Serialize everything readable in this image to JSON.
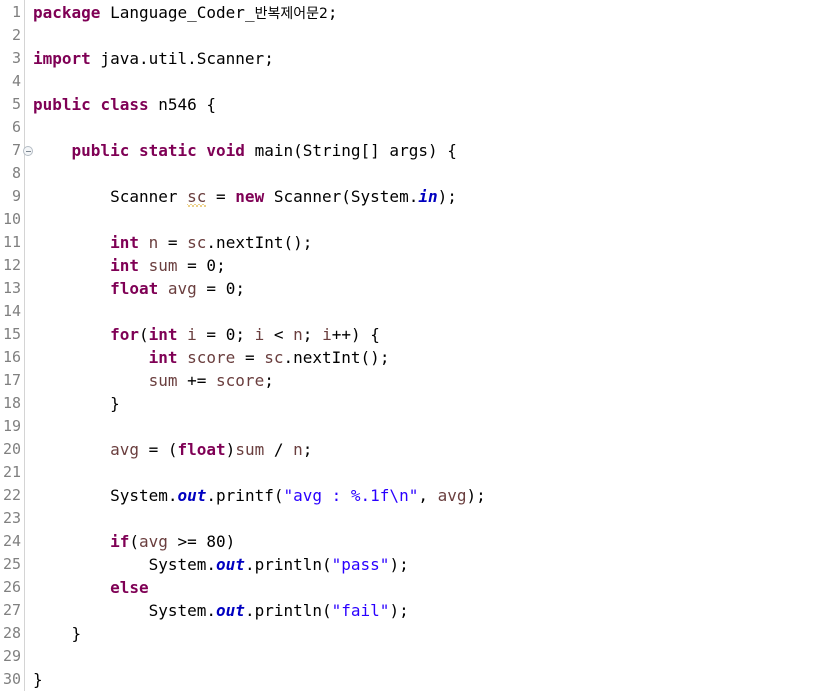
{
  "editor": {
    "language": "Java",
    "file_name": "n546.java",
    "total_lines": 30,
    "colors": {
      "background": "#ffffff",
      "gutter_text": "#808080",
      "gutter_border": "#d4d4d4",
      "keyword": "#7f0055",
      "string": "#2a00ff",
      "static_field": "#0000c0",
      "local_variable": "#6a3e3e",
      "plain_text": "#000000",
      "spell_warning": "#d9a013"
    },
    "fold_markers": [
      7
    ],
    "spell_warnings": [
      "sc"
    ]
  },
  "lines": [
    {
      "n": "1",
      "fold": false,
      "indent": 0,
      "tokens": [
        {
          "t": "package",
          "c": "kw"
        },
        {
          "t": " ",
          "c": "plain"
        },
        {
          "t": "Language_Coder_",
          "c": "plain"
        },
        {
          "t": "반복제어문2",
          "c": "hangul"
        },
        {
          "t": ";",
          "c": "plain"
        }
      ]
    },
    {
      "n": "2",
      "fold": false,
      "indent": 0,
      "tokens": []
    },
    {
      "n": "3",
      "fold": false,
      "indent": 0,
      "tokens": [
        {
          "t": "import",
          "c": "kw"
        },
        {
          "t": " java.util.Scanner;",
          "c": "plain"
        }
      ]
    },
    {
      "n": "4",
      "fold": false,
      "indent": 0,
      "tokens": []
    },
    {
      "n": "5",
      "fold": false,
      "indent": 0,
      "tokens": [
        {
          "t": "public",
          "c": "kw"
        },
        {
          "t": " ",
          "c": "plain"
        },
        {
          "t": "class",
          "c": "kw"
        },
        {
          "t": " n546 {",
          "c": "plain"
        }
      ]
    },
    {
      "n": "6",
      "fold": false,
      "indent": 0,
      "tokens": []
    },
    {
      "n": "7",
      "fold": true,
      "indent": 0,
      "tokens": [
        {
          "t": "    ",
          "c": "plain"
        },
        {
          "t": "public",
          "c": "kw"
        },
        {
          "t": " ",
          "c": "plain"
        },
        {
          "t": "static",
          "c": "kw"
        },
        {
          "t": " ",
          "c": "plain"
        },
        {
          "t": "void",
          "c": "kw"
        },
        {
          "t": " main(String[] args) {",
          "c": "plain"
        }
      ]
    },
    {
      "n": "8",
      "fold": false,
      "indent": 0,
      "tokens": []
    },
    {
      "n": "9",
      "fold": false,
      "indent": 0,
      "tokens": [
        {
          "t": "        Scanner ",
          "c": "plain"
        },
        {
          "t": "sc",
          "c": "localvar squiggle"
        },
        {
          "t": " = ",
          "c": "plain"
        },
        {
          "t": "new",
          "c": "kw"
        },
        {
          "t": " Scanner(System.",
          "c": "plain"
        },
        {
          "t": "in",
          "c": "statfld"
        },
        {
          "t": ");",
          "c": "plain"
        }
      ]
    },
    {
      "n": "10",
      "fold": false,
      "indent": 0,
      "tokens": []
    },
    {
      "n": "11",
      "fold": false,
      "indent": 0,
      "tokens": [
        {
          "t": "        ",
          "c": "plain"
        },
        {
          "t": "int",
          "c": "kw"
        },
        {
          "t": " ",
          "c": "plain"
        },
        {
          "t": "n",
          "c": "localvar"
        },
        {
          "t": " = ",
          "c": "plain"
        },
        {
          "t": "sc",
          "c": "localvar"
        },
        {
          "t": ".nextInt();",
          "c": "plain"
        }
      ]
    },
    {
      "n": "12",
      "fold": false,
      "indent": 0,
      "tokens": [
        {
          "t": "        ",
          "c": "plain"
        },
        {
          "t": "int",
          "c": "kw"
        },
        {
          "t": " ",
          "c": "plain"
        },
        {
          "t": "sum",
          "c": "localvar"
        },
        {
          "t": " = ",
          "c": "plain"
        },
        {
          "t": "0",
          "c": "num"
        },
        {
          "t": ";",
          "c": "plain"
        }
      ]
    },
    {
      "n": "13",
      "fold": false,
      "indent": 0,
      "tokens": [
        {
          "t": "        ",
          "c": "plain"
        },
        {
          "t": "float",
          "c": "kw"
        },
        {
          "t": " ",
          "c": "plain"
        },
        {
          "t": "avg",
          "c": "localvar"
        },
        {
          "t": " = ",
          "c": "plain"
        },
        {
          "t": "0",
          "c": "num"
        },
        {
          "t": ";",
          "c": "plain"
        }
      ]
    },
    {
      "n": "14",
      "fold": false,
      "indent": 0,
      "tokens": []
    },
    {
      "n": "15",
      "fold": false,
      "indent": 0,
      "tokens": [
        {
          "t": "        ",
          "c": "plain"
        },
        {
          "t": "for",
          "c": "kw"
        },
        {
          "t": "(",
          "c": "plain"
        },
        {
          "t": "int",
          "c": "kw"
        },
        {
          "t": " ",
          "c": "plain"
        },
        {
          "t": "i",
          "c": "localvar"
        },
        {
          "t": " = ",
          "c": "plain"
        },
        {
          "t": "0",
          "c": "num"
        },
        {
          "t": "; ",
          "c": "plain"
        },
        {
          "t": "i",
          "c": "localvar"
        },
        {
          "t": " < ",
          "c": "plain"
        },
        {
          "t": "n",
          "c": "localvar"
        },
        {
          "t": "; ",
          "c": "plain"
        },
        {
          "t": "i",
          "c": "localvar"
        },
        {
          "t": "++) {",
          "c": "plain"
        }
      ]
    },
    {
      "n": "16",
      "fold": false,
      "indent": 0,
      "tokens": [
        {
          "t": "            ",
          "c": "plain"
        },
        {
          "t": "int",
          "c": "kw"
        },
        {
          "t": " ",
          "c": "plain"
        },
        {
          "t": "score",
          "c": "localvar"
        },
        {
          "t": " = ",
          "c": "plain"
        },
        {
          "t": "sc",
          "c": "localvar"
        },
        {
          "t": ".nextInt();",
          "c": "plain"
        }
      ]
    },
    {
      "n": "17",
      "fold": false,
      "indent": 0,
      "tokens": [
        {
          "t": "            ",
          "c": "plain"
        },
        {
          "t": "sum",
          "c": "localvar"
        },
        {
          "t": " += ",
          "c": "plain"
        },
        {
          "t": "score",
          "c": "localvar"
        },
        {
          "t": ";",
          "c": "plain"
        }
      ]
    },
    {
      "n": "18",
      "fold": false,
      "indent": 0,
      "tokens": [
        {
          "t": "        }",
          "c": "plain"
        }
      ]
    },
    {
      "n": "19",
      "fold": false,
      "indent": 0,
      "tokens": []
    },
    {
      "n": "20",
      "fold": false,
      "indent": 0,
      "tokens": [
        {
          "t": "        ",
          "c": "plain"
        },
        {
          "t": "avg",
          "c": "localvar"
        },
        {
          "t": " = (",
          "c": "plain"
        },
        {
          "t": "float",
          "c": "kw"
        },
        {
          "t": ")",
          "c": "plain"
        },
        {
          "t": "sum",
          "c": "localvar"
        },
        {
          "t": " / ",
          "c": "plain"
        },
        {
          "t": "n",
          "c": "localvar"
        },
        {
          "t": ";",
          "c": "plain"
        }
      ]
    },
    {
      "n": "21",
      "fold": false,
      "indent": 0,
      "tokens": []
    },
    {
      "n": "22",
      "fold": false,
      "indent": 0,
      "tokens": [
        {
          "t": "        System.",
          "c": "plain"
        },
        {
          "t": "out",
          "c": "statfld"
        },
        {
          "t": ".printf(",
          "c": "plain"
        },
        {
          "t": "\"avg : %.1f\\n\"",
          "c": "str"
        },
        {
          "t": ", ",
          "c": "plain"
        },
        {
          "t": "avg",
          "c": "localvar"
        },
        {
          "t": ");",
          "c": "plain"
        }
      ]
    },
    {
      "n": "23",
      "fold": false,
      "indent": 0,
      "tokens": []
    },
    {
      "n": "24",
      "fold": false,
      "indent": 0,
      "tokens": [
        {
          "t": "        ",
          "c": "plain"
        },
        {
          "t": "if",
          "c": "kw"
        },
        {
          "t": "(",
          "c": "plain"
        },
        {
          "t": "avg",
          "c": "localvar"
        },
        {
          "t": " >= ",
          "c": "plain"
        },
        {
          "t": "80",
          "c": "num"
        },
        {
          "t": ")",
          "c": "plain"
        }
      ]
    },
    {
      "n": "25",
      "fold": false,
      "indent": 0,
      "tokens": [
        {
          "t": "            System.",
          "c": "plain"
        },
        {
          "t": "out",
          "c": "statfld"
        },
        {
          "t": ".println(",
          "c": "plain"
        },
        {
          "t": "\"pass\"",
          "c": "str"
        },
        {
          "t": ");",
          "c": "plain"
        }
      ]
    },
    {
      "n": "26",
      "fold": false,
      "indent": 0,
      "tokens": [
        {
          "t": "        ",
          "c": "plain"
        },
        {
          "t": "else",
          "c": "kw"
        }
      ]
    },
    {
      "n": "27",
      "fold": false,
      "indent": 0,
      "tokens": [
        {
          "t": "            System.",
          "c": "plain"
        },
        {
          "t": "out",
          "c": "statfld"
        },
        {
          "t": ".println(",
          "c": "plain"
        },
        {
          "t": "\"fail\"",
          "c": "str"
        },
        {
          "t": ");",
          "c": "plain"
        }
      ]
    },
    {
      "n": "28",
      "fold": false,
      "indent": 0,
      "tokens": [
        {
          "t": "    }",
          "c": "plain"
        }
      ]
    },
    {
      "n": "29",
      "fold": false,
      "indent": 0,
      "tokens": []
    },
    {
      "n": "30",
      "fold": false,
      "indent": 0,
      "tokens": [
        {
          "t": "}",
          "c": "plain"
        }
      ]
    }
  ],
  "source_text": "package Language_Coder_반복제어문2;\n\nimport java.util.Scanner;\n\npublic class n546 {\n\n    public static void main(String[] args) {\n\n        Scanner sc = new Scanner(System.in);\n\n        int n = sc.nextInt();\n        int sum = 0;\n        float avg = 0;\n\n        for(int i = 0; i < n; i++) {\n            int score = sc.nextInt();\n            sum += score;\n        }\n\n        avg = (float)sum / n;\n\n        System.out.printf(\"avg : %.1f\\n\", avg);\n\n        if(avg >= 80)\n            System.out.println(\"pass\");\n        else\n            System.out.println(\"fail\");\n    }\n\n}"
}
